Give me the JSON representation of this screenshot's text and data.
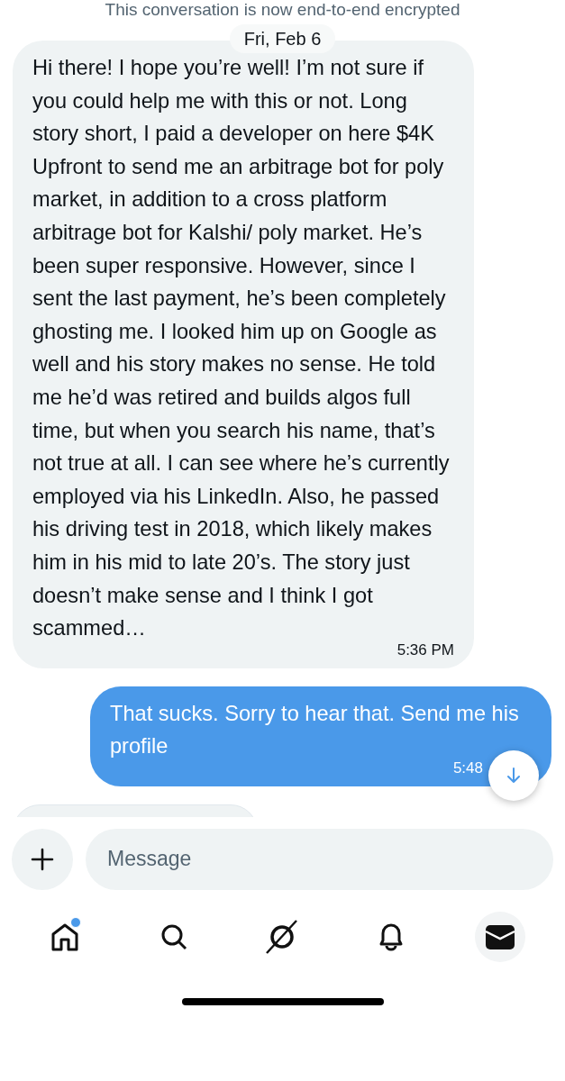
{
  "encryption_notice": "This conversation is now end-to-end encrypted",
  "date_label": "Fri, Feb 6",
  "messages": [
    {
      "kind": "incoming",
      "text": "Hi there! I hope you’re well! I’m not sure if you could help me with this or not. Long story short, I paid a developer on here $4K Upfront to send me an arbitrage bot for poly market, in addition to a cross platform arbitrage bot for Kalshi/ poly market. He’s been super responsive. However, since I sent the last payment, he’s been completely ghosting me. I looked him up on Google as well and his story makes no sense. He told me he’d was retired and builds algos full time, but when you search his name, that’s not true at all. I can see where he’s currently employed via his LinkedIn. Also, he passed his driving test in 2018, which likely makes him in his mid to late 20’s. The story just doesn’t make sense and I think I got scammed…",
      "time": "5:36 PM"
    },
    {
      "kind": "outgoing",
      "text": "That sucks. Sorry to hear that. Send me his profile",
      "time": "5:48"
    }
  ],
  "composer": {
    "placeholder": "Message"
  },
  "nav": [
    {
      "kind": "home",
      "selected": false,
      "badge": true
    },
    {
      "kind": "search",
      "selected": false,
      "badge": false
    },
    {
      "kind": "grok",
      "selected": false,
      "badge": false
    },
    {
      "kind": "bell",
      "selected": false,
      "badge": false
    },
    {
      "kind": "mail",
      "selected": true,
      "badge": false
    }
  ]
}
